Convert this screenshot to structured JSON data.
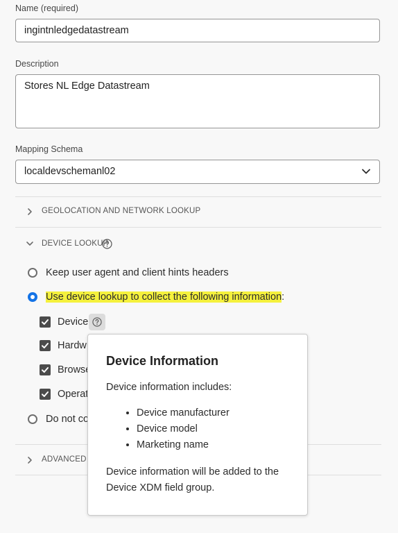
{
  "form": {
    "name_label": "Name (required)",
    "name_value": "ingintnledgedatastream",
    "description_label": "Description",
    "description_value": "Stores NL Edge Datastream",
    "schema_label": "Mapping Schema",
    "schema_value": "localdevschemanl02"
  },
  "sections": {
    "geolocation": "GEOLOCATION AND NETWORK LOOKUP",
    "device_lookup": "DEVICE LOOKUP",
    "advanced": "ADVANCED C"
  },
  "device_lookup": {
    "option_keep": "Keep user agent and client hints headers",
    "option_use": "Use device lookup to collect the following information",
    "option_use_suffix": ":",
    "option_do_not": "Do not co",
    "checkboxes": [
      "Device",
      "Hardw",
      "Browse",
      "Operat"
    ]
  },
  "popover": {
    "title": "Device Information",
    "intro": "Device information includes:",
    "items": [
      "Device manufacturer",
      "Device model",
      "Marketing name"
    ],
    "footer": "Device information will be added to the Device XDM field group."
  },
  "colors": {
    "accent": "#1473e6",
    "highlight": "#f5f13d"
  }
}
